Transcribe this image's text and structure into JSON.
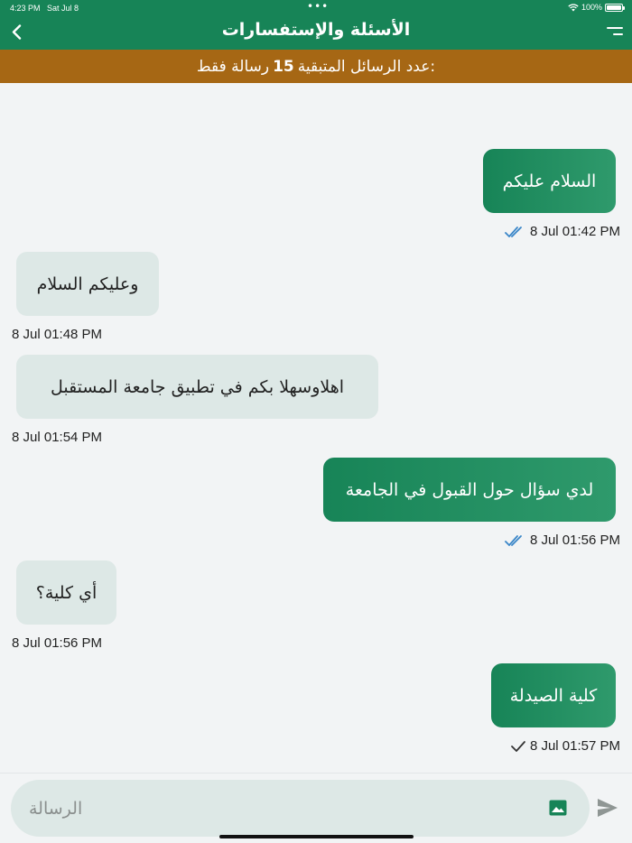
{
  "status_bar": {
    "time": "4:23 PM",
    "date": "Sat Jul 8",
    "dots": "•••",
    "battery": "100%"
  },
  "header": {
    "title": "الأسئلة والإستفسارات"
  },
  "banner": {
    "prefix": "عدد الرسائل المتبقية:",
    "count": "15",
    "suffix": "رسالة فقط"
  },
  "messages": [
    {
      "direction": "out",
      "text": "السلام عليكم",
      "timestamp": "8 Jul 01:42 PM",
      "status": "read"
    },
    {
      "direction": "in",
      "text": "وعليكم السلام",
      "timestamp": "8 Jul 01:48 PM"
    },
    {
      "direction": "in",
      "text": "اهلاوسهلا بكم في تطبيق جامعة المستقبل",
      "timestamp": "8 Jul 01:54 PM"
    },
    {
      "direction": "out",
      "text": "لدي سؤال حول القبول في الجامعة",
      "timestamp": "8 Jul 01:56 PM",
      "status": "read"
    },
    {
      "direction": "in",
      "text": "أي كلية؟",
      "timestamp": "8 Jul 01:56 PM"
    },
    {
      "direction": "out",
      "text": "كلية الصيدلة",
      "timestamp": "8 Jul 01:57 PM",
      "status": "sent"
    }
  ],
  "composer": {
    "placeholder": "الرسالة"
  },
  "colors": {
    "primary": "#178457",
    "banner": "#a66714",
    "incoming_bubble": "#dde8e6",
    "read_tick": "#3a86c8"
  }
}
